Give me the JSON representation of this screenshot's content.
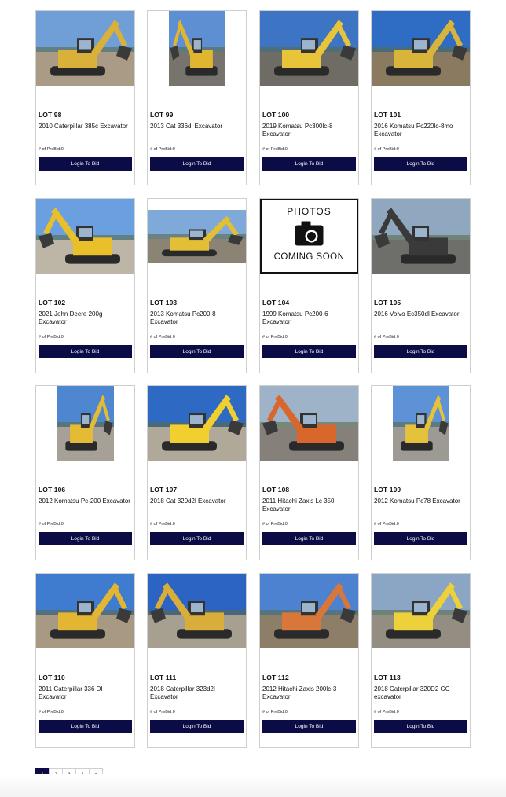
{
  "lots": [
    {
      "lot": "LOT 98",
      "title": "2010 Caterpillar 385c Excavator",
      "prebid": "# of PreBid:0",
      "button": "Login To Bid",
      "photo": "excavator-photo",
      "colors": {
        "sky": "#6f9fd6",
        "ground": "#a99b86",
        "machine": "#d9b13a"
      }
    },
    {
      "lot": "LOT 99",
      "title": "2013 Cat 336dl Excavator",
      "prebid": "# of PreBid:0",
      "button": "Login To Bid",
      "photo": "excavator-photo",
      "colors": {
        "sky": "#5d8fd2",
        "ground": "#77746e",
        "machine": "#e0b52f"
      }
    },
    {
      "lot": "LOT 100",
      "title": "2019 Komatsu Pc300lc-8 Excavator",
      "prebid": "# of PreBid:0",
      "button": "Login To Bid",
      "photo": "excavator-photo",
      "colors": {
        "sky": "#3d74c4",
        "ground": "#6f6c65",
        "machine": "#e8c43a"
      }
    },
    {
      "lot": "LOT 101",
      "title": "2016 Komatsu Pc220lc-8mo Excavator",
      "prebid": "# of PreBid:0",
      "button": "Login To Bid",
      "photo": "excavator-photo",
      "colors": {
        "sky": "#2f6cc4",
        "ground": "#8a7a60",
        "machine": "#d8b43a"
      }
    },
    {
      "lot": "LOT 102",
      "title": "2021 John Deere 200g Excavator",
      "prebid": "# of PreBid:0",
      "button": "Login To Bid",
      "photo": "excavator-photo",
      "colors": {
        "sky": "#6aa0df",
        "ground": "#bdb6a7",
        "machine": "#e9c02a"
      }
    },
    {
      "lot": "LOT 103",
      "title": "2013 Komatsu Pc200-8 Excavator",
      "prebid": "# of PreBid:0",
      "button": "Login To Bid",
      "photo": "excavator-photo",
      "colors": {
        "sky": "#7fa9d8",
        "ground": "#8b8474",
        "machine": "#e2bf35"
      }
    },
    {
      "lot": "LOT 104",
      "title": "1999 Komatsu Pc200-6 Excavator",
      "prebid": "# of PreBid:0",
      "button": "Login To Bid",
      "photo": "photos-coming-soon",
      "placeholder_line1": "PHOTOS",
      "placeholder_line2": "COMING SOON"
    },
    {
      "lot": "LOT 105",
      "title": "2016 Volvo Ec350dl Excavator",
      "prebid": "# of PreBid:0",
      "button": "Login To Bid",
      "photo": "excavator-photo",
      "colors": {
        "sky": "#8fa7bf",
        "ground": "#6e6e6b",
        "machine": "#3a3a3a"
      }
    },
    {
      "lot": "LOT 106",
      "title": "2012 Komatsu Pc-200 Excavator",
      "prebid": "# of PreBid:0",
      "button": "Login To Bid",
      "photo": "excavator-photo",
      "colors": {
        "sky": "#4f86d0",
        "ground": "#a6a096",
        "machine": "#e3bb34"
      }
    },
    {
      "lot": "LOT 107",
      "title": "2018 Cat 320d2l Excavator",
      "prebid": "# of PreBid:0",
      "button": "Login To Bid",
      "photo": "excavator-photo",
      "colors": {
        "sky": "#2e6ac4",
        "ground": "#b0a898",
        "machine": "#f0cf2e"
      }
    },
    {
      "lot": "LOT 108",
      "title": "2011 Hitachi Zaxis Lc 350 Excavator",
      "prebid": "# of PreBid:0",
      "button": "Login To Bid",
      "photo": "excavator-photo",
      "colors": {
        "sky": "#9fb3c8",
        "ground": "#858079",
        "machine": "#d9662a"
      }
    },
    {
      "lot": "LOT 109",
      "title": "2012 Komatsu Pc78 Excavator",
      "prebid": "# of PreBid:0",
      "button": "Login To Bid",
      "photo": "excavator-photo",
      "colors": {
        "sky": "#5e92d6",
        "ground": "#9d9a94",
        "machine": "#e4c23c"
      }
    },
    {
      "lot": "LOT 110",
      "title": "2011 Caterpillar 336 Dl Excavator",
      "prebid": "# of PreBid:0",
      "button": "Login To Bid",
      "photo": "excavator-photo",
      "colors": {
        "sky": "#3f7cd0",
        "ground": "#a89a82",
        "machine": "#e2b633"
      }
    },
    {
      "lot": "LOT 111",
      "title": "2018 Caterpillar 323d2l Excavator",
      "prebid": "# of PreBid:0",
      "button": "Login To Bid",
      "photo": "excavator-photo",
      "colors": {
        "sky": "#2b64c2",
        "ground": "#a79f8f",
        "machine": "#d8ad3a"
      }
    },
    {
      "lot": "LOT 112",
      "title": "2012 Hitachi Zaxis 200lc-3 Excavator",
      "prebid": "# of PreBid:0",
      "button": "Login To Bid",
      "photo": "excavator-photo",
      "colors": {
        "sky": "#4c82cf",
        "ground": "#8d7e68",
        "machine": "#d9773a"
      }
    },
    {
      "lot": "LOT 113",
      "title": "2018 Caterpillar 320D2 GC excavator",
      "prebid": "# of PreBid:0",
      "button": "Login To Bid",
      "photo": "excavator-photo",
      "colors": {
        "sky": "#8aa6c4",
        "ground": "#938d82",
        "machine": "#ecd13a"
      }
    }
  ],
  "pagination": {
    "pages": [
      "1",
      "2",
      "3",
      "4",
      "»"
    ],
    "current": "1"
  },
  "colors": {
    "accent": "#0b0b45",
    "border": "#cfcfcf"
  }
}
